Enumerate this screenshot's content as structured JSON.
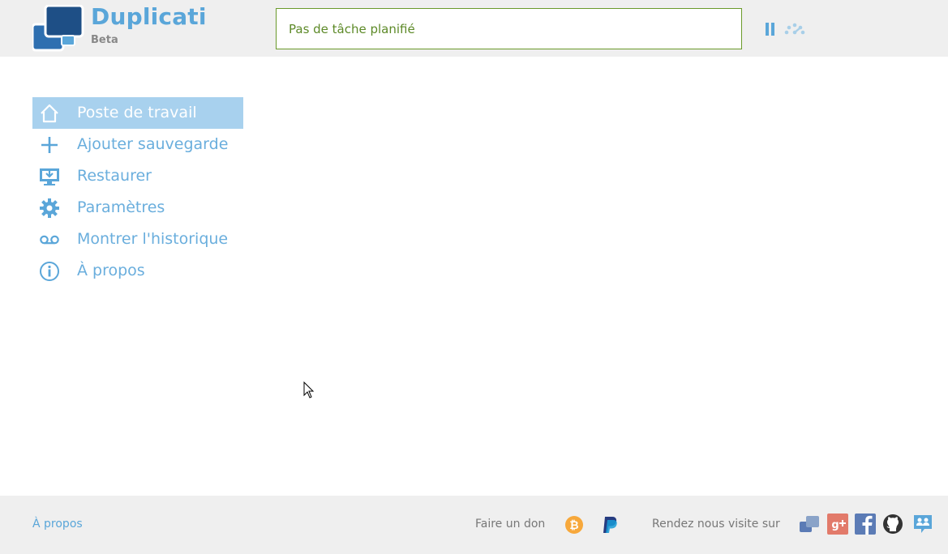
{
  "header": {
    "app_name": "Duplicati",
    "app_subtitle": "Beta",
    "status_text": "Pas de tâche planifié",
    "icons": {
      "logo": "duplicati-logo-icon",
      "pause": "pause-icon",
      "throttle": "throttle-icon"
    }
  },
  "nav": {
    "items": [
      {
        "label": "Poste de travail",
        "icon": "home-icon",
        "active": true
      },
      {
        "label": "Ajouter sauvegarde",
        "icon": "plus-icon",
        "active": false
      },
      {
        "label": "Restaurer",
        "icon": "restore-icon",
        "active": false
      },
      {
        "label": "Paramètres",
        "icon": "gear-icon",
        "active": false
      },
      {
        "label": "Montrer l'historique",
        "icon": "voicemail-icon",
        "active": false
      },
      {
        "label": "À propos",
        "icon": "info-icon",
        "active": false
      }
    ]
  },
  "footer": {
    "about_label": "À propos",
    "donate_label": "Faire un don",
    "visit_label": "Rendez nous visite sur",
    "donate_icons": [
      "bitcoin-icon",
      "paypal-icon"
    ],
    "social_icons": [
      "duplicati-forum-icon",
      "google-plus-icon",
      "facebook-icon",
      "github-icon",
      "user-group-icon"
    ]
  },
  "colors": {
    "accent": "#5aa6d9",
    "nav_active_bg": "#a8d1ee",
    "status_border": "#6a9a2a",
    "status_text": "#5d8a28",
    "header_bg": "#efefef",
    "bitcoin": "#f7a83b",
    "paypal_dark": "#253b80",
    "paypal_light": "#179bd7",
    "google_plus": "#e27a6a",
    "facebook": "#5b7bb5",
    "github": "#333333"
  }
}
